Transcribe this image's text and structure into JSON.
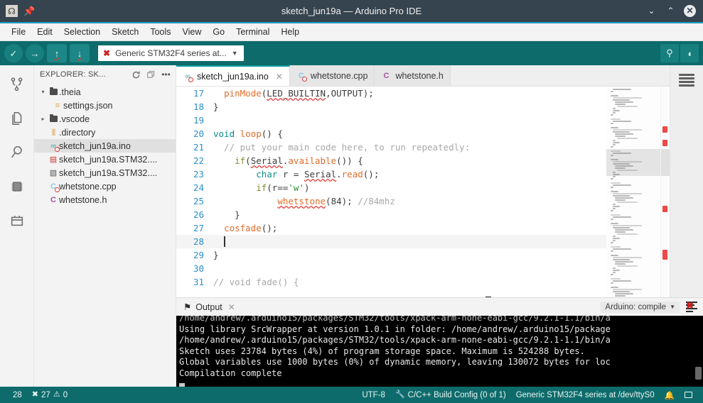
{
  "titlebar": {
    "title": "sketch_jun19a — Arduino Pro IDE",
    "logo_icon": "arduino-logo-icon",
    "pin_icon": "pin-icon",
    "minimize_label": "⌄",
    "maximize_label": "⌃",
    "close_label": "✕"
  },
  "menubar": {
    "items": [
      {
        "label": "File"
      },
      {
        "label": "Edit"
      },
      {
        "label": "Selection"
      },
      {
        "label": "Sketch"
      },
      {
        "label": "Tools"
      },
      {
        "label": "View"
      },
      {
        "label": "Go"
      },
      {
        "label": "Terminal"
      },
      {
        "label": "Help"
      }
    ]
  },
  "toolbar": {
    "verify_icon": "checkmark-icon",
    "verify_glyph": "✓",
    "upload_icon": "arrow-right-icon",
    "upload_glyph": "→",
    "up_glyph": "↑",
    "down_glyph": "↓",
    "board": {
      "error_mark": "✖",
      "label": "Generic STM32F4 series at...",
      "caret": "▼"
    },
    "search_glyph": "⚲",
    "monitor_glyph": "◖"
  },
  "activitybar": {
    "items": [
      {
        "name": "source-control-icon"
      },
      {
        "name": "explorer-files-icon"
      },
      {
        "name": "search-icon"
      },
      {
        "name": "boards-manager-icon"
      },
      {
        "name": "library-manager-icon"
      }
    ]
  },
  "explorer": {
    "title": "EXPLORER: SK...",
    "refresh_icon": "refresh-icon",
    "collapse_icon": "collapse-all-icon",
    "more_icon": "more-actions-icon",
    "more_glyph": "•••",
    "tree": [
      {
        "label": ".theia",
        "type": "folder",
        "expanded": true,
        "twisty": "▾",
        "indent": 0,
        "selected": false,
        "glyph": "",
        "color": "#4c4c4c",
        "error": false
      },
      {
        "label": "settings.json",
        "type": "json",
        "twisty": "",
        "indent": 1,
        "selected": false,
        "glyph": "≡",
        "color": "#e8a33d",
        "error": false
      },
      {
        "label": ".vscode",
        "type": "folder",
        "expanded": false,
        "twisty": "▸",
        "indent": 0,
        "selected": false,
        "glyph": "",
        "color": "#4c4c4c",
        "error": false
      },
      {
        "label": ".directory",
        "type": "config",
        "twisty": "",
        "indent": 0,
        "selected": false,
        "glyph": "⫿a",
        "color": "#e8a33d",
        "error": false
      },
      {
        "label": "sketch_jun19a.ino",
        "type": "ino",
        "twisty": "",
        "indent": 0,
        "selected": true,
        "glyph": "∞",
        "color": "#3aa69a",
        "error": true
      },
      {
        "label": "sketch_jun19a.STM32....",
        "type": "bin",
        "twisty": "",
        "indent": 0,
        "selected": false,
        "glyph": "▤",
        "color": "#c9352c",
        "error": false
      },
      {
        "label": "sketch_jun19a.STM32....",
        "type": "file",
        "twisty": "",
        "indent": 0,
        "selected": false,
        "glyph": "▧",
        "color": "#555555",
        "error": false
      },
      {
        "label": "whetstone.cpp",
        "type": "cpp",
        "twisty": "",
        "indent": 0,
        "selected": false,
        "glyph": "C",
        "color": "#8fc7e8",
        "error": true
      },
      {
        "label": "whetstone.h",
        "type": "header",
        "twisty": "",
        "indent": 0,
        "selected": false,
        "glyph": "C",
        "color": "#a855a8",
        "error": false
      }
    ]
  },
  "tabs": [
    {
      "label": "sketch_jun19a.ino",
      "active": true,
      "glyph": "∞",
      "color": "#3aa69a",
      "error": true,
      "close": "✕"
    },
    {
      "label": "whetstone.cpp",
      "active": false,
      "glyph": "C",
      "color": "#8fc7e8",
      "error": true,
      "close": ""
    },
    {
      "label": "whetstone.h",
      "active": false,
      "glyph": "C",
      "color": "#a855a8",
      "error": false,
      "close": ""
    }
  ],
  "editor": {
    "cursor_line": 28,
    "lines": [
      {
        "num": 17,
        "indent": 1,
        "tokens": [
          {
            "t": "  ",
            "c": "t-plain"
          },
          {
            "t": "pinMode",
            "c": "t-fn"
          },
          {
            "t": "(",
            "c": "t-plain"
          },
          {
            "t": "LED_BUILTIN",
            "c": "t-plain sq"
          },
          {
            "t": ",OUTPUT);",
            "c": "t-plain"
          }
        ]
      },
      {
        "num": 18,
        "indent": 0,
        "tokens": [
          {
            "t": "}",
            "c": "t-plain"
          }
        ]
      },
      {
        "num": 19,
        "indent": 0,
        "tokens": []
      },
      {
        "num": 20,
        "indent": 0,
        "tokens": [
          {
            "t": "void",
            "c": "t-kw"
          },
          {
            "t": " ",
            "c": "t-plain"
          },
          {
            "t": "loop",
            "c": "t-fn"
          },
          {
            "t": "() {",
            "c": "t-plain"
          }
        ]
      },
      {
        "num": 21,
        "indent": 1,
        "tokens": [
          {
            "t": "  // put your main code here, to run repeatedly:",
            "c": "t-cmt"
          }
        ]
      },
      {
        "num": 22,
        "indent": 1,
        "tokens": [
          {
            "t": "    ",
            "c": "t-plain"
          },
          {
            "t": "if",
            "c": "t-ctl"
          },
          {
            "t": "(",
            "c": "t-plain"
          },
          {
            "t": "Serial",
            "c": "t-plain sq"
          },
          {
            "t": ".",
            "c": "t-plain"
          },
          {
            "t": "available",
            "c": "t-fn"
          },
          {
            "t": "()) {",
            "c": "t-plain"
          }
        ]
      },
      {
        "num": 23,
        "indent": 2,
        "tokens": [
          {
            "t": "        ",
            "c": "t-plain"
          },
          {
            "t": "char",
            "c": "t-type"
          },
          {
            "t": " r = ",
            "c": "t-plain"
          },
          {
            "t": "Serial",
            "c": "t-plain sq"
          },
          {
            "t": ".",
            "c": "t-plain"
          },
          {
            "t": "read",
            "c": "t-fn"
          },
          {
            "t": "();",
            "c": "t-plain"
          }
        ]
      },
      {
        "num": 24,
        "indent": 2,
        "tokens": [
          {
            "t": "        ",
            "c": "t-plain"
          },
          {
            "t": "if",
            "c": "t-ctl"
          },
          {
            "t": "(r==",
            "c": "t-plain"
          },
          {
            "t": "'w'",
            "c": "t-str"
          },
          {
            "t": ")",
            "c": "t-plain"
          }
        ]
      },
      {
        "num": 25,
        "indent": 3,
        "tokens": [
          {
            "t": "            ",
            "c": "t-plain"
          },
          {
            "t": "whetstone",
            "c": "t-fn sq"
          },
          {
            "t": "(84); ",
            "c": "t-plain"
          },
          {
            "t": "//84mhz",
            "c": "t-cmt"
          }
        ]
      },
      {
        "num": 26,
        "indent": 1,
        "tokens": [
          {
            "t": "    }",
            "c": "t-plain"
          }
        ]
      },
      {
        "num": 27,
        "indent": 1,
        "tokens": [
          {
            "t": "  ",
            "c": "t-plain"
          },
          {
            "t": "cosfade",
            "c": "t-fn"
          },
          {
            "t": "();",
            "c": "t-plain"
          }
        ]
      },
      {
        "num": 28,
        "indent": 1,
        "tokens": [
          {
            "t": "  ",
            "c": "t-plain"
          }
        ]
      },
      {
        "num": 29,
        "indent": 0,
        "tokens": [
          {
            "t": "}",
            "c": "t-plain"
          }
        ]
      },
      {
        "num": 30,
        "indent": 0,
        "tokens": []
      },
      {
        "num": 31,
        "indent": 0,
        "tokens": [
          {
            "t": "// void fade() {",
            "c": "t-cmt"
          }
        ]
      }
    ]
  },
  "rightbar": {
    "outline_icon": "outline-list-icon"
  },
  "panel": {
    "tab_label": "Output",
    "tab_icon": "output-flag-icon",
    "tab_glyph": "⚑",
    "close_glyph": "✕",
    "channel": "Arduino: compile",
    "channel_caret": "▼",
    "clear_icon": "clear-output-icon",
    "lines": [
      "/home/andrew/.arduino15/packages/STM32/tools/xpack-arm-none-eabi-gcc/9.2.1-1.1/bin/a",
      "Using library SrcWrapper at version 1.0.1 in folder: /home/andrew/.arduino15/package",
      "/home/andrew/.arduino15/packages/STM32/tools/xpack-arm-none-eabi-gcc/9.2.1-1.1/bin/a",
      "Sketch uses 23784 bytes (4%) of program storage space. Maximum is 524288 bytes.",
      "Global variables use 1000 bytes (0%) of dynamic memory, leaving 130072 bytes for loc",
      "Compilation complete"
    ]
  },
  "statusbar": {
    "cursor": "28",
    "error_glyph": "✖",
    "errors": "27",
    "warning_glyph": "⚠",
    "warnings": "0",
    "encoding": "UTF-8",
    "build_icon": "wrench-icon",
    "build_glyph": "ὒ7",
    "build_config": "C/C++ Build Config (0 of 1)",
    "board_port": "Generic STM32F4 series at /dev/ttyS0",
    "bell_icon": "notification-bell-icon",
    "bell_glyph": "ὑ4",
    "layout_icon": "toggle-panel-icon"
  }
}
